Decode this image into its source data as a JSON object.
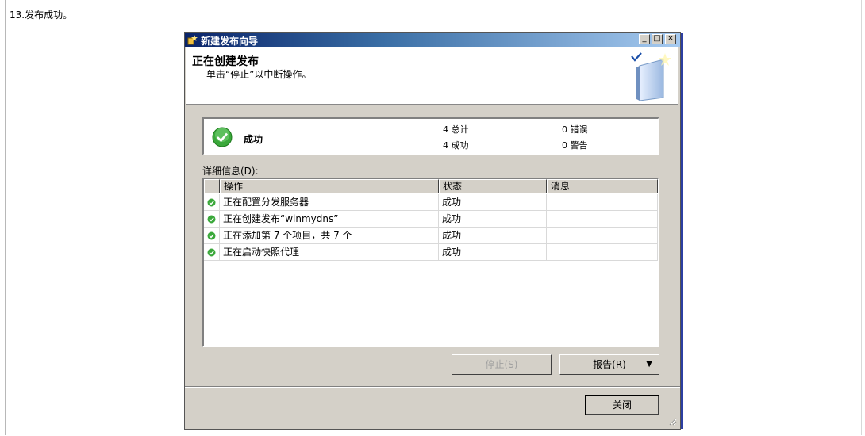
{
  "caption": "13.发布成功。",
  "window": {
    "title": "新建发布向导",
    "min": "_",
    "max": "□",
    "close": "×"
  },
  "header": {
    "title": "正在创建发布",
    "subtitle": "单击“停止”以中断操作。"
  },
  "summary": {
    "result": "成功",
    "total": "4 总计",
    "success": "4 成功",
    "errors": "0 错误",
    "warnings": "0 警告"
  },
  "details": {
    "label": "详细信息(D):",
    "columns": [
      "操作",
      "状态",
      "消息"
    ],
    "rows": [
      {
        "action": "正在配置分发服务器",
        "status": "成功",
        "message": ""
      },
      {
        "action": "正在创建发布“winmydns”",
        "status": "成功",
        "message": ""
      },
      {
        "action": "正在添加第 7 个项目，共 7 个",
        "status": "成功",
        "message": ""
      },
      {
        "action": "正在启动快照代理",
        "status": "成功",
        "message": ""
      }
    ]
  },
  "buttons": {
    "stop": "停止(S)",
    "report": "报告(R)",
    "close": "关闭"
  },
  "colors": {
    "titlebar": "#0a246a",
    "dialog_bg": "#d4d0c8",
    "success_green": "#3aa83a"
  }
}
